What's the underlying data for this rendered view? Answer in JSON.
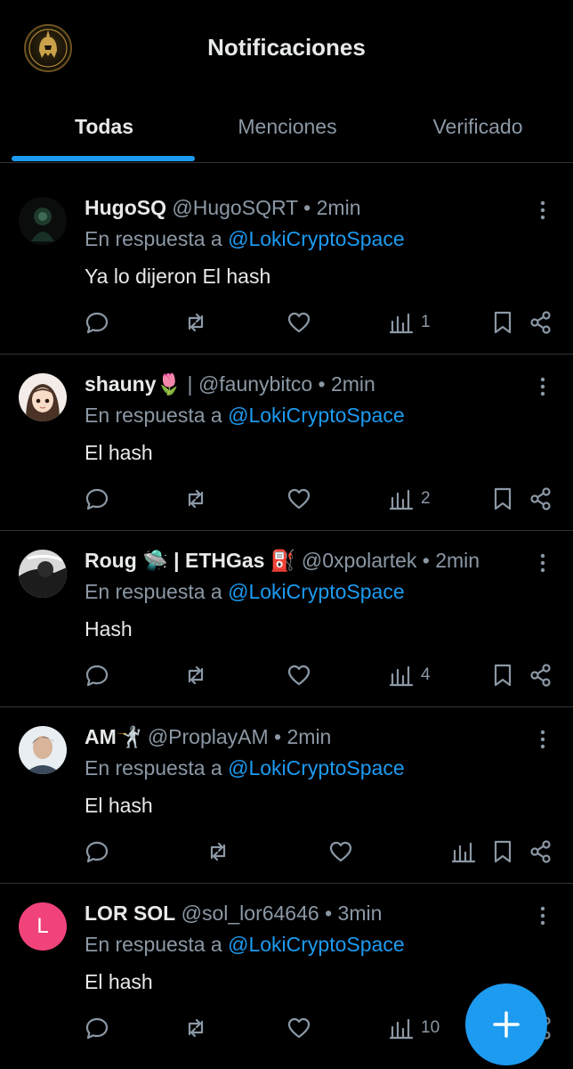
{
  "header": {
    "title": "Notificaciones",
    "logo_icon": "helmet-logo"
  },
  "tabs": [
    {
      "label": "Todas",
      "active": true
    },
    {
      "label": "Menciones",
      "active": false
    },
    {
      "label": "Verificado",
      "active": false
    }
  ],
  "colors": {
    "accent": "#1d9bf0",
    "background": "#000000",
    "muted": "#8b98a5",
    "avatar_l": "#f0437a"
  },
  "notifications": [
    {
      "name": "HugoSQ",
      "handle": "@HugoSQRT",
      "sep": " • ",
      "time": "2min",
      "reply_prefix": "En respuesta a ",
      "reply_to": "@LokiCryptoSpace",
      "text": "Ya lo dijeron El hash",
      "views": "1",
      "avatar": "dark-image-avatar"
    },
    {
      "name": "shauny🌷",
      "name_suffix": " | ",
      "handle": "@faunybitco",
      "sep": " • ",
      "time": "2min",
      "reply_prefix": "En respuesta a ",
      "reply_to": "@LokiCryptoSpace",
      "text": "El hash",
      "views": "2",
      "avatar": "anime-girl-avatar"
    },
    {
      "name": "Roug 🛸 | ETHGas ⛽",
      "handle": "@0xpolartek",
      "sep": " • ",
      "time": "2min",
      "reply_prefix": "En respuesta a ",
      "reply_to": "@LokiCryptoSpace",
      "text": "Hash",
      "views": "4",
      "avatar": "photo-avatar"
    },
    {
      "name": "AM🤺",
      "handle": "@ProplayAM",
      "sep": " • ",
      "time": "2min",
      "reply_prefix": "En respuesta a ",
      "reply_to": "@LokiCryptoSpace",
      "text": "El hash",
      "views": "",
      "avatar": "person-avatar"
    },
    {
      "name": "LOR SOL",
      "handle": "@sol_lor64646",
      "sep": " • ",
      "time": "3min",
      "reply_prefix": "En respuesta a ",
      "reply_to": "@LokiCryptoSpace",
      "text": "El hash",
      "views": "10",
      "avatar": "letter-avatar",
      "avatar_letter": "L"
    }
  ],
  "fab": {
    "icon": "plus-icon"
  }
}
